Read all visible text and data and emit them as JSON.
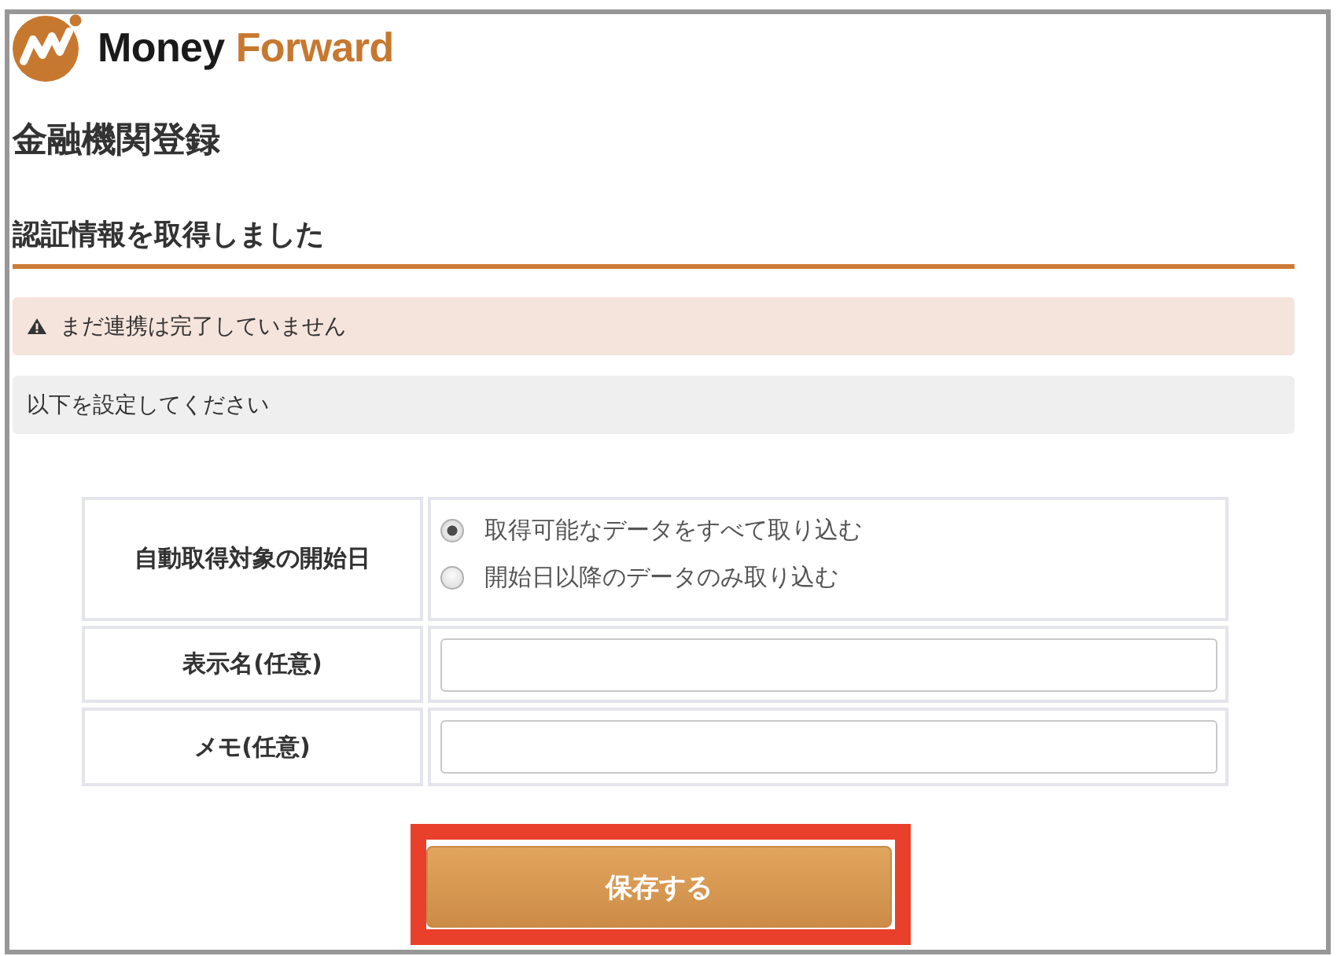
{
  "logo": {
    "words": [
      "Money",
      "Forward"
    ]
  },
  "page_title": "金融機関登録",
  "section_heading": "認証情報を取得しました",
  "notices": [
    {
      "kind": "warning",
      "text": "まだ連携は完了していません"
    },
    {
      "kind": "info",
      "text": "以下を設定してください"
    }
  ],
  "form": {
    "rows": [
      {
        "kind": "radio",
        "label": "自動取得対象の開始日",
        "options": [
          {
            "label": "取得可能なデータをすべて取り込む",
            "selected": true
          },
          {
            "label": "開始日以降のデータのみ取り込む",
            "selected": false
          }
        ]
      },
      {
        "kind": "text",
        "label": "表示名(任意)"
      },
      {
        "kind": "text",
        "label": "メモ(任意)"
      }
    ]
  },
  "save_button": {
    "label": "保存する",
    "highlighted": true
  }
}
